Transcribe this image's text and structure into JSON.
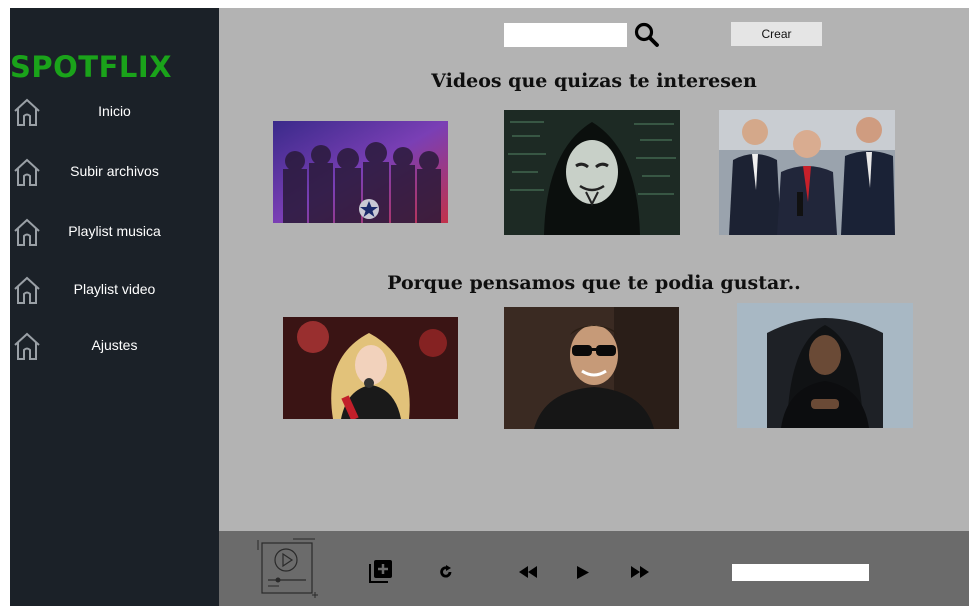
{
  "sidebar": {
    "logo": "SPOTFLIX",
    "items": [
      {
        "label": "Inicio",
        "icon": "home-icon"
      },
      {
        "label": "Subir archivos",
        "icon": "home-icon"
      },
      {
        "label": "Playlist musica",
        "icon": "home-icon"
      },
      {
        "label": "Playlist video",
        "icon": "home-icon"
      },
      {
        "label": "Ajustes",
        "icon": "home-icon"
      }
    ]
  },
  "header": {
    "search": {
      "value": "",
      "placeholder": "",
      "icon": "search-icon"
    },
    "create_label": "Crear"
  },
  "main": {
    "section1_title": "Videos que quizas te interesen",
    "section2_title": "Porque pensamos que te podia gustar.."
  },
  "player": {
    "icons": [
      "video-player-icon",
      "add-to-playlist-icon",
      "repeat-icon",
      "rewind-icon",
      "play-icon",
      "fast-forward-icon"
    ],
    "track_field_value": ""
  },
  "colors": {
    "sidebar_bg": "#1b2128",
    "logo": "#1aa31a",
    "main_bg": "#b3b3b3",
    "bottom_bar_bg": "#6b6b6b"
  }
}
